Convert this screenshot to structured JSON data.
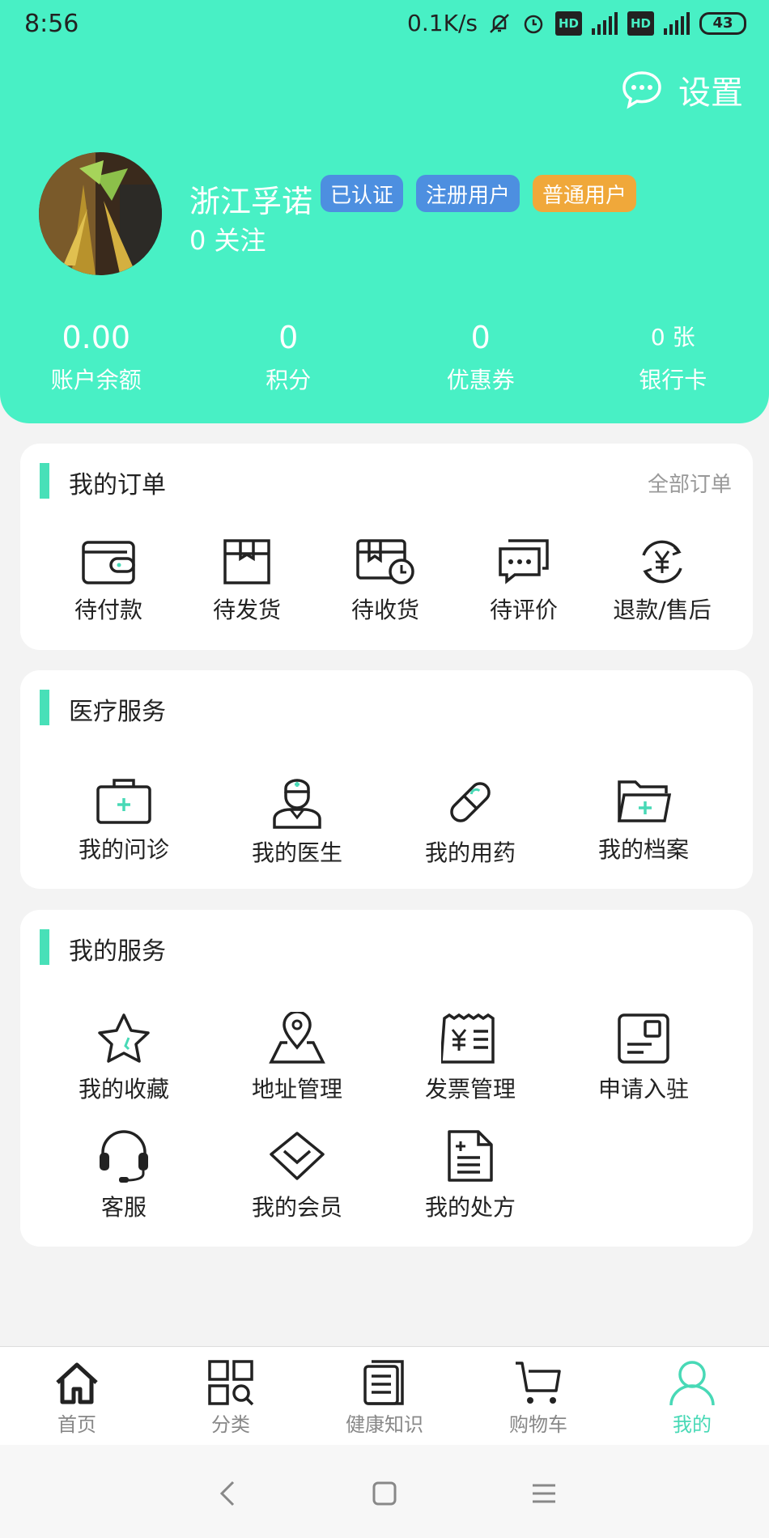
{
  "status_bar": {
    "time": "8:56",
    "speed": "0.1K/s",
    "battery": "43",
    "hd1": "HD",
    "hd2": "HD"
  },
  "header": {
    "settings_label": "设置",
    "username": "浙江孚诺",
    "badges": [
      "已认证",
      "注册用户",
      "普通用户"
    ],
    "follow": "0 关注"
  },
  "stats": [
    {
      "value": "0.00",
      "label": "账户余额"
    },
    {
      "value": "0",
      "label": "积分"
    },
    {
      "value": "0",
      "label": "优惠券"
    },
    {
      "value": "0 张",
      "label": "银行卡"
    }
  ],
  "orders": {
    "title": "我的订单",
    "more": "全部订单",
    "items": [
      {
        "label": "待付款",
        "icon": "wallet-icon"
      },
      {
        "label": "待发货",
        "icon": "box-icon"
      },
      {
        "label": "待收货",
        "icon": "delivery-clock-icon"
      },
      {
        "label": "待评价",
        "icon": "comment-icon"
      },
      {
        "label": "退款/售后",
        "icon": "refund-icon"
      }
    ]
  },
  "medical": {
    "title": "医疗服务",
    "items": [
      {
        "label": "我的问诊",
        "icon": "medical-kit-icon"
      },
      {
        "label": "我的医生",
        "icon": "doctor-icon"
      },
      {
        "label": "我的用药",
        "icon": "pill-icon"
      },
      {
        "label": "我的档案",
        "icon": "folder-icon"
      }
    ]
  },
  "services": {
    "title": "我的服务",
    "items": [
      {
        "label": "我的收藏",
        "icon": "star-icon"
      },
      {
        "label": "地址管理",
        "icon": "location-icon"
      },
      {
        "label": "发票管理",
        "icon": "invoice-icon"
      },
      {
        "label": "申请入驻",
        "icon": "apply-icon"
      },
      {
        "label": "客服",
        "icon": "headset-icon"
      },
      {
        "label": "我的会员",
        "icon": "diamond-icon"
      },
      {
        "label": "我的处方",
        "icon": "prescription-icon"
      }
    ]
  },
  "tabbar": [
    {
      "label": "首页",
      "icon": "home-icon"
    },
    {
      "label": "分类",
      "icon": "category-icon"
    },
    {
      "label": "健康知识",
      "icon": "news-icon"
    },
    {
      "label": "购物车",
      "icon": "cart-icon"
    },
    {
      "label": "我的",
      "icon": "user-icon",
      "active": true
    }
  ],
  "colors": {
    "accent": "#48f0c5",
    "badge_blue": "#4d8fe0",
    "badge_orange": "#f0a83a",
    "active_tab": "#48d9b6"
  }
}
